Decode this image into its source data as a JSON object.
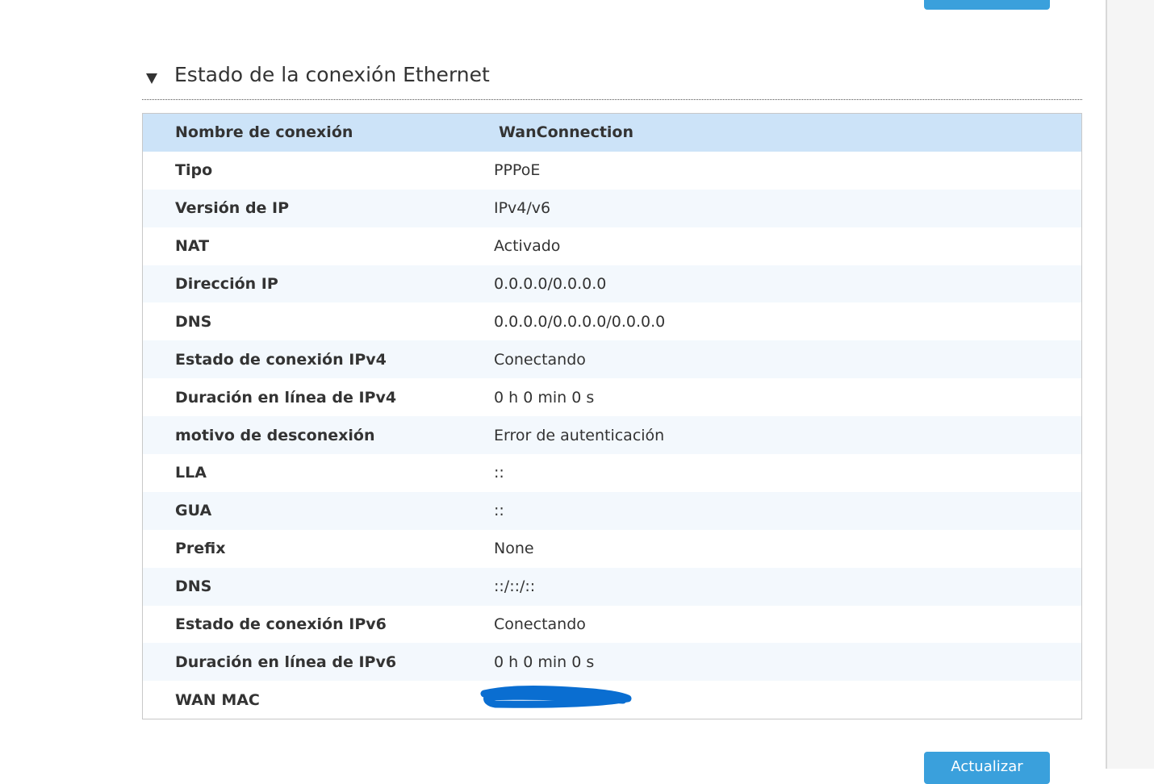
{
  "section": {
    "title": "Estado de la conexión Ethernet"
  },
  "table": {
    "rows": [
      {
        "label": "Nombre de conexión",
        "value": "WanConnection"
      },
      {
        "label": "Tipo",
        "value": "PPPoE"
      },
      {
        "label": "Versión de IP",
        "value": "IPv4/v6"
      },
      {
        "label": "NAT",
        "value": "Activado"
      },
      {
        "label": "Dirección IP",
        "value": "0.0.0.0/0.0.0.0"
      },
      {
        "label": "DNS",
        "value": "0.0.0.0/0.0.0.0/0.0.0.0"
      },
      {
        "label": "Estado de conexión IPv4",
        "value": "Conectando"
      },
      {
        "label": "Duración en línea de IPv4",
        "value": "0 h 0 min 0 s"
      },
      {
        "label": "motivo de desconexión",
        "value": "Error de autenticación"
      },
      {
        "label": "LLA",
        "value": "::"
      },
      {
        "label": "GUA",
        "value": "::"
      },
      {
        "label": "Prefix",
        "value": "None"
      },
      {
        "label": "DNS",
        "value": "::/::/::"
      },
      {
        "label": "Estado de conexión IPv6",
        "value": "Conectando"
      },
      {
        "label": "Duración en línea de IPv6",
        "value": "0 h 0 min 0 s"
      },
      {
        "label": "WAN MAC",
        "value": ""
      }
    ]
  },
  "buttons": {
    "refresh_label": "Actualizar"
  },
  "colors": {
    "header_row": "#cce3f8",
    "alt_row": "#f3f8fd",
    "button": "#3aa0dc",
    "redaction": "#0a6ed1"
  },
  "icons": {
    "toggle": "triangle-down-icon"
  }
}
